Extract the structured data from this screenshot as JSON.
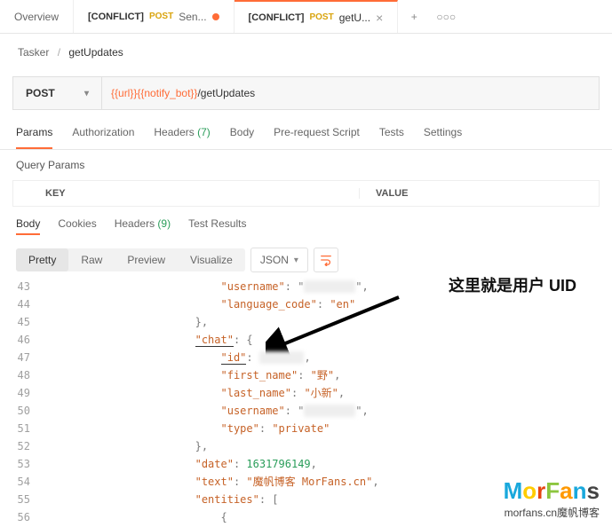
{
  "tabs": {
    "overview": "Overview",
    "tab1": {
      "conflict": "[CONFLICT]",
      "method": "POST",
      "title": "Sen..."
    },
    "tab2": {
      "conflict": "[CONFLICT]",
      "method": "POST",
      "title": "getU..."
    },
    "plus": "+",
    "more": "○○○"
  },
  "breadcrumb": {
    "root": "Tasker",
    "sep": "/",
    "current": "getUpdates"
  },
  "url": {
    "method": "POST",
    "var": "{{url}}{{notify_bot}}",
    "path": "/getUpdates"
  },
  "req_tabs": {
    "params": "Params",
    "authorization": "Authorization",
    "headers_label": "Headers",
    "headers_count": "(7)",
    "body": "Body",
    "prerequest": "Pre-request Script",
    "tests": "Tests",
    "settings": "Settings"
  },
  "query_params_title": "Query Params",
  "kv": {
    "key": "KEY",
    "value": "VALUE"
  },
  "resp_tabs": {
    "body": "Body",
    "cookies": "Cookies",
    "headers_label": "Headers",
    "headers_count": "(9)",
    "test_results": "Test Results"
  },
  "toolbar": {
    "pretty": "Pretty",
    "raw": "Raw",
    "preview": "Preview",
    "visualize": "Visualize",
    "format": "JSON"
  },
  "annotation": "这里就是用户 UID",
  "code": {
    "l43": {
      "key": "\"username\"",
      "val_blur": "        "
    },
    "l44": {
      "key": "\"language_code\"",
      "val": "\"en\""
    },
    "l46": {
      "key": "\"chat\""
    },
    "l47": {
      "key": "\"id\"",
      "val_blur": "       "
    },
    "l48": {
      "key": "\"first_name\"",
      "val": "\"野\""
    },
    "l49": {
      "key": "\"last_name\"",
      "val": "\"小新\""
    },
    "l50": {
      "key": "\"username\"",
      "val_blur": "        "
    },
    "l51": {
      "key": "\"type\"",
      "val": "\"private\""
    },
    "l53": {
      "key": "\"date\"",
      "num": "1631796149"
    },
    "l54": {
      "key": "\"text\"",
      "val": "\"魔帆博客 MorFans.cn\""
    },
    "l55": {
      "key": "\"entities\""
    }
  },
  "watermark": {
    "logo": "MorFans",
    "sub": "morfans.cn魔帆博客"
  }
}
